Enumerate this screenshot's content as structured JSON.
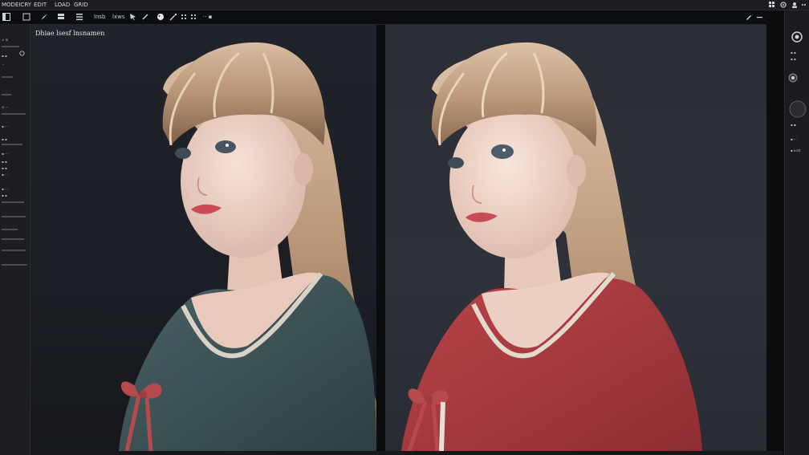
{
  "menubar": {
    "app_title": "MODEICRY",
    "items": [
      "EDIT",
      "LOAD",
      "GRID"
    ]
  },
  "toolbar": {
    "labels": [
      "lnsb",
      "lxws"
    ],
    "right_label": "·· ▪"
  },
  "left_panel": {
    "rows": [
      "≡ ⊞",
      "▪ ▪",
      "⌃",
      "",
      "",
      "",
      "",
      "⊟ ···",
      "",
      "▪ ···",
      "",
      "▪ ▪",
      "▪ ···",
      "",
      "▪ ▪",
      "▪ ▪",
      "▪ ···",
      "",
      "▪ ···",
      "▪ ▪"
    ]
  },
  "viewport": {
    "left_title": "Dhiae lsesf lnsnamen"
  },
  "right_panel": {
    "rows": [
      "▪ ▪",
      "▪ ▪",
      "▪ ▪",
      "▪ ···",
      "▪ Lcet"
    ]
  },
  "colors": {
    "accent": "#d9dbde",
    "left_sweater": "#3c5256",
    "right_sweater": "#a53a3d",
    "bow": "#b54a4d",
    "hair": "#c9a98c"
  }
}
